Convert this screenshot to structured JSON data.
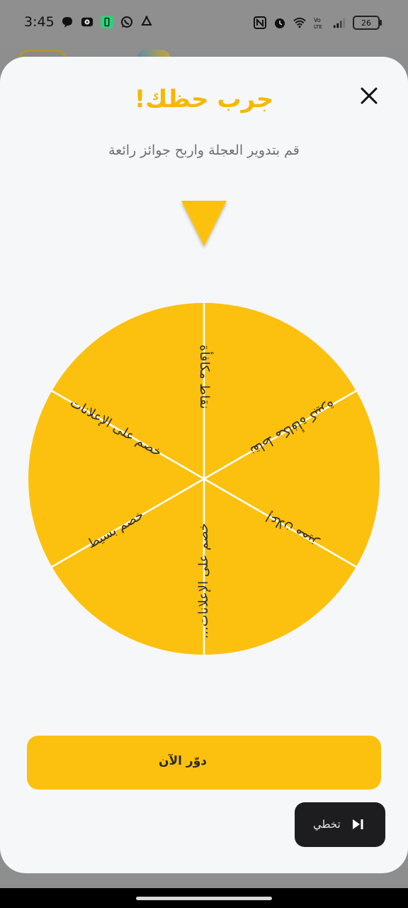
{
  "status_bar": {
    "time": "3:45",
    "battery": "26",
    "left_icons": [
      "chat-bubble-icon",
      "youtube-icon",
      "app-icon",
      "whatsapp-icon",
      "recycle-icon"
    ],
    "right_icons": [
      "nfc-icon",
      "alarm-icon",
      "wifi-icon",
      "volte-icon",
      "signal-icon"
    ]
  },
  "sheet": {
    "title": "جرب حظك!",
    "subtitle": "قم بتدوير العجلة واربح جوائز رائعة",
    "close_icon": "close-icon"
  },
  "wheel": {
    "colors": {
      "segment": "#fcc10e",
      "divider": "#ffffff",
      "text": "#2b2b2b",
      "pointer": "#fcc10e"
    },
    "segments": [
      {
        "label": "نقاط مكافأة"
      },
      {
        "label": "نقاط مكافأة كبيرة"
      },
      {
        "label": "إعلان مميز"
      },
      {
        "label": "خصم على الإعلانات..."
      },
      {
        "label": "خصم بسيط"
      },
      {
        "label": "خصم على الإعلانات"
      }
    ]
  },
  "actions": {
    "spin_label": "دوّر الآن",
    "skip_label": "تخطي",
    "skip_icon": "skip-next-icon"
  },
  "colors": {
    "accent": "#fcc10e",
    "title": "#f5b800",
    "sheet_bg": "#f6f7f9",
    "skip_bg": "#1d1d1f"
  }
}
